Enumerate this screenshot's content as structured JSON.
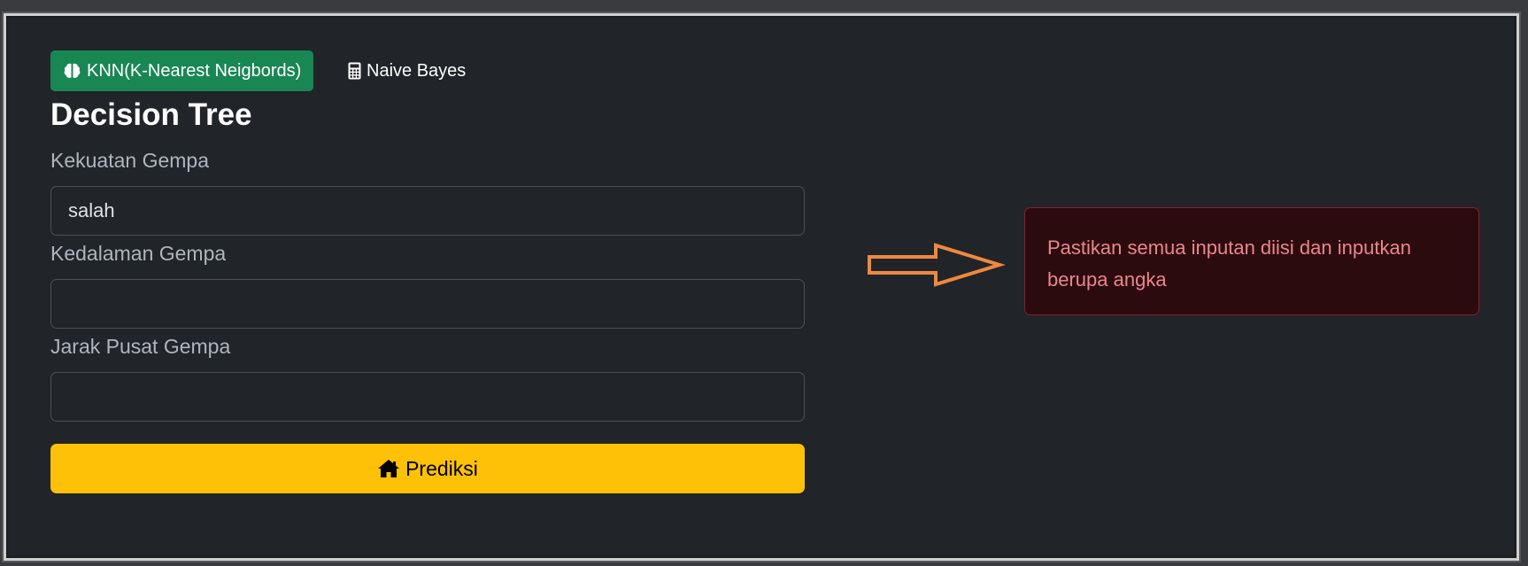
{
  "nav": {
    "knn_label": "KNN(K-Nearest Neigbords)",
    "knn_icon": "brain-icon",
    "naive_bayes_label": "Naive Bayes",
    "naive_bayes_icon": "calculator-icon"
  },
  "page": {
    "title": "Decision Tree"
  },
  "form": {
    "fields": [
      {
        "label": "Kekuatan Gempa",
        "value": "salah"
      },
      {
        "label": "Kedalaman Gempa",
        "value": ""
      },
      {
        "label": "Jarak Pusat Gempa",
        "value": ""
      }
    ],
    "submit_label": "Prediksi",
    "submit_icon": "home-icon"
  },
  "alert": {
    "message": "Pastikan semua inputan diisi dan inputkan berupa angka",
    "arrow_icon": "arrow-right-icon"
  },
  "colors": {
    "background": "#212529",
    "knn_button": "#198754",
    "submit_button": "#ffc107",
    "arrow": "#f0883e",
    "alert_background": "#2c0b0e",
    "alert_text": "#ea868f",
    "alert_border": "#842029"
  }
}
